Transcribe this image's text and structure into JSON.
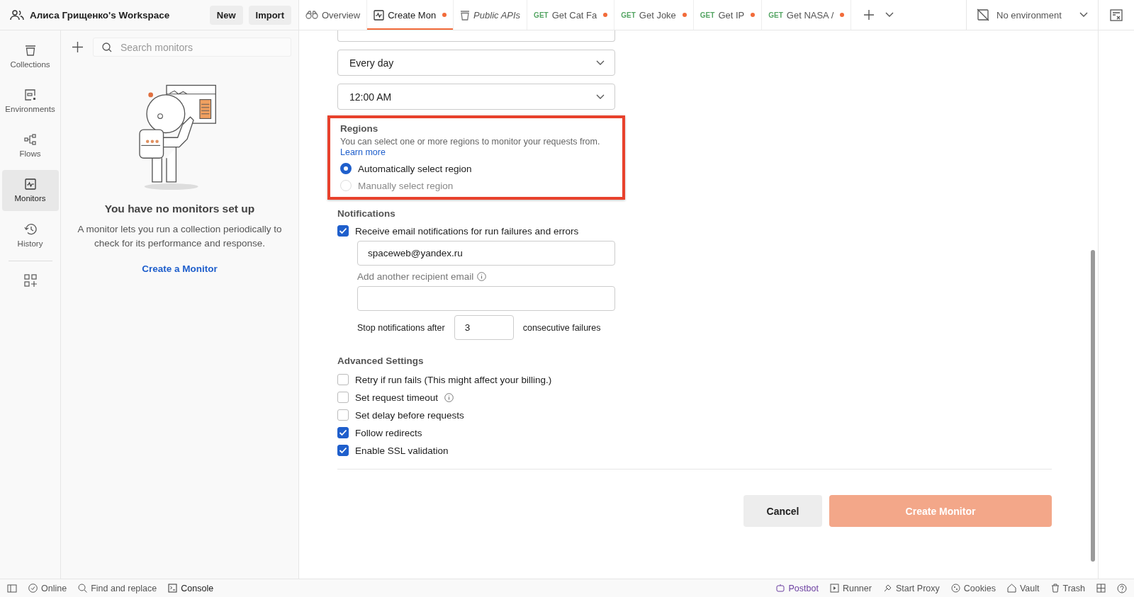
{
  "workspace": {
    "name": "Алиса Грищенко's Workspace",
    "buttons": [
      "New",
      "Import"
    ]
  },
  "tabs": [
    {
      "kind": "overview",
      "label": "Overview",
      "selected": false,
      "unsaved": false,
      "preview": false
    },
    {
      "kind": "monitor",
      "label": "Create Mon",
      "selected": true,
      "unsaved": true,
      "preview": false
    },
    {
      "kind": "collection",
      "label": "Public APIs",
      "selected": false,
      "unsaved": false,
      "preview": true
    },
    {
      "kind": "request",
      "method": "GET",
      "label": "Get Cat Fa",
      "selected": false,
      "unsaved": true,
      "preview": false
    },
    {
      "kind": "request",
      "method": "GET",
      "label": "Get Joke",
      "selected": false,
      "unsaved": true,
      "preview": false
    },
    {
      "kind": "request",
      "method": "GET",
      "label": "Get IP",
      "selected": false,
      "unsaved": true,
      "preview": false
    },
    {
      "kind": "request",
      "method": "GET",
      "label": "Get NASA /",
      "selected": false,
      "unsaved": true,
      "preview": false
    }
  ],
  "environment": {
    "label": "No environment"
  },
  "nav": [
    {
      "kind": "collections",
      "label": "Collections",
      "selected": false
    },
    {
      "kind": "environments",
      "label": "Environments",
      "selected": false
    },
    {
      "kind": "flows",
      "label": "Flows",
      "selected": false
    },
    {
      "kind": "monitors",
      "label": "Monitors",
      "selected": true
    },
    {
      "kind": "history",
      "label": "History",
      "selected": false
    }
  ],
  "sidebar": {
    "search_placeholder": "Search monitors",
    "empty_title": "You have no monitors set up",
    "empty_text": "A monitor lets you run a collection periodically to check for its performance and response.",
    "create_link": "Create a Monitor"
  },
  "schedule": [
    "Every day",
    "12:00 AM"
  ],
  "regions": {
    "title": "Regions",
    "description": "You can select one or more regions to monitor your requests from.",
    "link": "Learn more",
    "highlighted": true,
    "options": [
      {
        "label": "Automatically select region",
        "selected": true,
        "disabled": false
      },
      {
        "label": "Manually select region",
        "selected": false,
        "disabled": true
      }
    ]
  },
  "notifications": {
    "title": "Notifications",
    "receive": {
      "label": "Receive email notifications for run failures and errors",
      "checked": true
    },
    "email": "spaceweb@yandex.ru",
    "add_label": "Add another recipient email",
    "stop_before": "Stop notifications after",
    "stop_value": "3",
    "stop_after": "consecutive failures"
  },
  "advanced": {
    "title": "Advanced Settings",
    "options": [
      {
        "label": "Retry if run fails (This might affect your billing.)",
        "checked": false,
        "info": false
      },
      {
        "label": "Set request timeout",
        "checked": false,
        "info": true
      },
      {
        "label": "Set delay before requests",
        "checked": false,
        "info": false
      },
      {
        "label": "Follow redirects",
        "checked": true,
        "info": false
      },
      {
        "label": "Enable SSL validation",
        "checked": true,
        "info": false
      }
    ]
  },
  "actions": {
    "cancel": "Cancel",
    "create": {
      "label": "Create Monitor",
      "disabled": true
    }
  },
  "status_bar": {
    "left": [
      {
        "kind": "online",
        "label": "Online"
      },
      {
        "kind": "find",
        "label": "Find and replace"
      },
      {
        "kind": "console",
        "label": "Console"
      }
    ],
    "right": [
      {
        "kind": "postbot",
        "label": "Postbot"
      },
      {
        "kind": "runner",
        "label": "Runner"
      },
      {
        "kind": "proxy",
        "label": "Start Proxy"
      },
      {
        "kind": "cookies",
        "label": "Cookies"
      },
      {
        "kind": "vault",
        "label": "Vault"
      },
      {
        "kind": "trash",
        "label": "Trash"
      }
    ]
  }
}
